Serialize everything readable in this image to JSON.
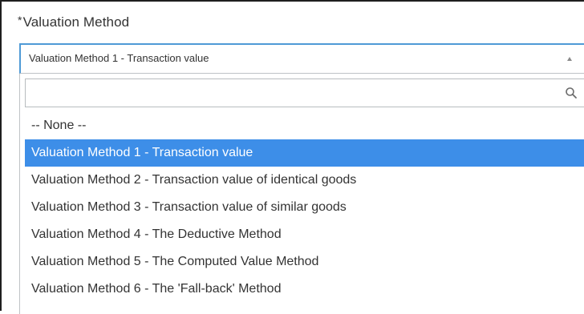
{
  "field": {
    "required_marker": "*",
    "label": "Valuation Method"
  },
  "select": {
    "value": "Valuation Method 1 - Transaction value",
    "caret_icon": "caret-up-icon"
  },
  "search": {
    "placeholder": "",
    "value": "",
    "icon": "search-icon"
  },
  "options": [
    {
      "label": "-- None --",
      "selected": false
    },
    {
      "label": "Valuation Method 1 - Transaction value",
      "selected": true
    },
    {
      "label": "Valuation Method 2 - Transaction value of identical goods",
      "selected": false
    },
    {
      "label": "Valuation Method 3 - Transaction value of similar goods",
      "selected": false
    },
    {
      "label": "Valuation Method 4 - The Deductive Method",
      "selected": false
    },
    {
      "label": "Valuation Method 5 - The Computed Value Method",
      "selected": false
    },
    {
      "label": "Valuation Method 6 - The 'Fall-back' Method",
      "selected": false
    }
  ],
  "colors": {
    "selected_bg": "#3d8ee8",
    "focus_border": "#4f9ad6"
  }
}
